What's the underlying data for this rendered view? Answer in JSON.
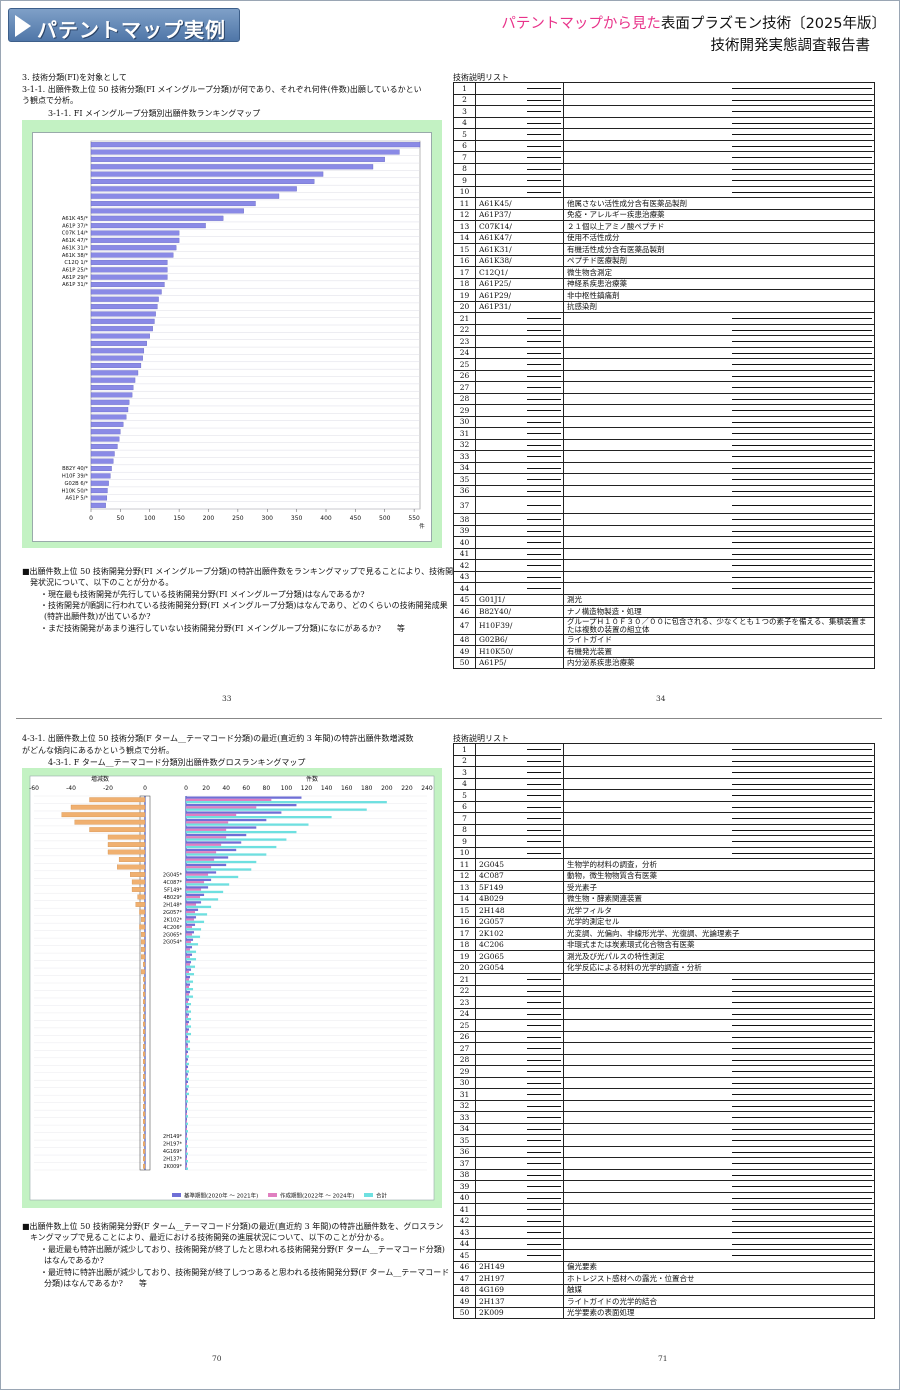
{
  "header": {
    "badge": "パテントマップ実例",
    "subtitle_pink": "パテントマップから見た",
    "subtitle_rest": "表面プラズモン技術〔2025年版〕",
    "subtitle_line2": "技術開発実態調査報告書"
  },
  "top": {
    "heading1": "3. 技術分類(FI)を対象として",
    "heading2": "3-1-1. 出願件数上位 50 技術分類(FI メイングループ分類)が何であり、それぞれ何件(件数)出願しているかとい",
    "heading3": "う観点で分析。",
    "chart_caption": "3-1-1. FI メイングループ分類別出願件数ランキングマップ",
    "notes": [
      "■出願件数上位 50 技術開発分野(FI メイングループ分類)の特許出願件数をランキングマップで見ることにより、技術開",
      "発状況について、以下のことが分かる。",
      "・現在最も技術開発が先行している技術開発分野(FI メイングループ分類)はなんであるか?",
      "・技術開発が順調に行われている技術開発分野(FI メイングループ分類)はなんであり、どのくらいの技術開発成果",
      "(特許出願件数)が出ているか?",
      "・まだ技術開発があまり進行していない技術開発分野(FI メイングループ分類)になにがあるか?　　等"
    ],
    "page_left": "33",
    "page_right": "34",
    "table_title": "技術説明リスト"
  },
  "bottom": {
    "heading1": "4-3-1. 出願件数上位 50 技術分類(F ターム__テーマコード分類)の最近(直近約 3 年間)の特許出願件数増減数",
    "heading2": "がどんな傾向にあるかという観点で分析。",
    "chart_caption": "4-3-1. F ターム__テーマコード分類別出願件数グロスランキングマップ",
    "notes": [
      "■出願件数上位 50 技術開発分野(F ターム__テーマコード分類)の最近(直近約 3 年間)の特許出願件数を、グロスラン",
      "キングマップで見ることにより、最近における技術開発の進展状況について、以下のことが分かる。",
      "・最近最も特許出願が減少しており、技術開発が終了したと思われる技術開発分野(F ターム__テーマコード分類)",
      "はなんであるか?",
      "・最近特に特許出願が減少しており、技術開発が終了しつつあると思われる技術開発分野(F ターム__テーマコード",
      "分類)はなんであるか?　　等"
    ],
    "page_left": "70",
    "page_right": "71",
    "table_title": "技術説明リスト"
  },
  "chart_data": [
    {
      "type": "bar",
      "orientation": "horizontal",
      "title": "3-1-1. FI メイングループ分類別出願件数ランキングマップ",
      "xlabel": "件",
      "xlim": [
        0,
        560
      ],
      "xticks": [
        0,
        50,
        100,
        150,
        200,
        250,
        300,
        350,
        400,
        450,
        500,
        550
      ],
      "grid": true,
      "categories": [
        "",
        "",
        "",
        "",
        "",
        "",
        "",
        "",
        "",
        "",
        "A61K 45/*",
        "A61P 37/*",
        "C07K 14/*",
        "A61K 47/*",
        "A61K 31/*",
        "A61K 38/*",
        "C12Q 1/*",
        "A61P 25/*",
        "A61P 29/*",
        "A61P 31/*",
        "",
        "",
        "",
        "",
        "",
        "",
        "",
        "",
        "",
        "",
        "",
        "",
        "",
        "",
        "",
        "",
        "",
        "",
        "",
        "",
        "",
        "",
        "",
        "",
        "B82Y 40/*",
        "H10F 39/*",
        "G02B 6/*",
        "H10K 50/*",
        "A61P 5/*",
        ""
      ],
      "values": [
        560,
        525,
        500,
        480,
        395,
        380,
        350,
        320,
        280,
        260,
        225,
        195,
        150,
        150,
        145,
        140,
        130,
        130,
        130,
        125,
        120,
        115,
        113,
        110,
        108,
        105,
        100,
        95,
        90,
        88,
        85,
        80,
        75,
        72,
        70,
        65,
        63,
        60,
        55,
        50,
        48,
        45,
        40,
        38,
        35,
        33,
        30,
        28,
        27,
        25
      ]
    },
    {
      "type": "bar",
      "orientation": "horizontal",
      "title": "4-3-1. F ターム__テーマコード分類別出願件数グロスランキングマップ",
      "panels": [
        {
          "xlabel": "増減数",
          "xlim": [
            -60,
            0
          ],
          "xticks": [
            -60,
            -40,
            -20,
            0
          ]
        },
        {
          "xlabel": "件数",
          "xlim": [
            0,
            240
          ],
          "xticks": [
            0,
            20,
            40,
            60,
            80,
            100,
            120,
            140,
            160,
            180,
            200,
            220,
            240
          ]
        }
      ],
      "legend": "bottom-right",
      "categories": [
        "",
        "",
        "",
        "",
        "",
        "",
        "",
        "",
        "",
        "",
        "2G045*",
        "4C087*",
        "5F149*",
        "4B029*",
        "2H148*",
        "2G057*",
        "2K102*",
        "4C206*",
        "2G065*",
        "2G054*",
        "",
        "",
        "",
        "",
        "",
        "",
        "",
        "",
        "",
        "",
        "",
        "",
        "",
        "",
        "",
        "",
        "",
        "",
        "",
        "",
        "",
        "",
        "",
        "",
        "",
        "2H149*",
        "2H197*",
        "4G169*",
        "2H137*",
        "2K009*"
      ],
      "series": [
        {
          "name": "基準期間(2020年 ～ 2021年)",
          "color": "#6f6fd6",
          "values": [
            115,
            110,
            95,
            80,
            70,
            60,
            55,
            50,
            42,
            40,
            30,
            25,
            22,
            18,
            15,
            12,
            10,
            9,
            8,
            7,
            6,
            6,
            5,
            5,
            4,
            4,
            4,
            3,
            3,
            3,
            3,
            3,
            2,
            2,
            2,
            2,
            2,
            2,
            2,
            2,
            1,
            1,
            1,
            1,
            1,
            1,
            1,
            1,
            1,
            1
          ]
        },
        {
          "name": "作成期間(2022年 ～ 2024年)",
          "color": "#e07fc0",
          "values": [
            85,
            70,
            50,
            42,
            40,
            40,
            35,
            30,
            28,
            25,
            22,
            18,
            15,
            14,
            10,
            9,
            8,
            6,
            6,
            5,
            4,
            4,
            4,
            3,
            3,
            3,
            3,
            2,
            2,
            2,
            2,
            2,
            2,
            2,
            1,
            1,
            1,
            1,
            1,
            1,
            1,
            1,
            1,
            1,
            1,
            1,
            1,
            1,
            1,
            1
          ]
        },
        {
          "name": "合計",
          "color": "#6ee0e0",
          "values": [
            200,
            180,
            145,
            122,
            110,
            100,
            90,
            80,
            70,
            65,
            52,
            43,
            37,
            32,
            25,
            21,
            18,
            15,
            14,
            12,
            10,
            10,
            9,
            8,
            7,
            7,
            7,
            5,
            5,
            5,
            5,
            5,
            4,
            4,
            3,
            3,
            3,
            3,
            3,
            3,
            2,
            2,
            2,
            2,
            2,
            2,
            2,
            2,
            2,
            2
          ]
        },
        {
          "name": "増減数",
          "color": "#f0b070",
          "values": [
            -30,
            -40,
            -45,
            -38,
            -30,
            -20,
            -20,
            -20,
            -14,
            -15,
            -8,
            -7,
            -7,
            -4,
            -5,
            -3,
            -2,
            -3,
            -2,
            -2,
            -2,
            -2,
            -1,
            -2,
            -1,
            -1,
            -1,
            -1,
            -1,
            -1,
            -1,
            -1,
            -1,
            -1,
            -1,
            -1,
            -1,
            -1,
            -1,
            -1,
            -1,
            -1,
            -1,
            -1,
            -1,
            -1,
            -1,
            -1,
            -1,
            -1
          ]
        }
      ]
    }
  ],
  "table_top": [
    {
      "n": "1"
    },
    {
      "n": "2"
    },
    {
      "n": "3"
    },
    {
      "n": "4"
    },
    {
      "n": "5"
    },
    {
      "n": "6"
    },
    {
      "n": "7"
    },
    {
      "n": "8"
    },
    {
      "n": "9"
    },
    {
      "n": "10"
    },
    {
      "n": "11",
      "code": "A61K45/",
      "desc": "他属さない活性成分含有医薬品製剤"
    },
    {
      "n": "12",
      "code": "A61P37/",
      "desc": "免疫・アレルギー疾患治療薬"
    },
    {
      "n": "13",
      "code": "C07K14/",
      "desc": "２１個以上アミノ酸ペプチド"
    },
    {
      "n": "14",
      "code": "A61K47/",
      "desc": "使用不活性成分"
    },
    {
      "n": "15",
      "code": "A61K31/",
      "desc": "有機活性成分含有医薬品製剤"
    },
    {
      "n": "16",
      "code": "A61K38/",
      "desc": "ペプチド医療製剤"
    },
    {
      "n": "17",
      "code": "C12Q1/",
      "desc": "微生物含測定"
    },
    {
      "n": "18",
      "code": "A61P25/",
      "desc": "神経系疾患治療薬"
    },
    {
      "n": "19",
      "code": "A61P29/",
      "desc": "非中枢性鎮痛剤"
    },
    {
      "n": "20",
      "code": "A61P31/",
      "desc": "抗感染剤"
    },
    {
      "n": "21"
    },
    {
      "n": "22"
    },
    {
      "n": "23"
    },
    {
      "n": "24"
    },
    {
      "n": "25"
    },
    {
      "n": "26"
    },
    {
      "n": "27"
    },
    {
      "n": "28"
    },
    {
      "n": "29"
    },
    {
      "n": "30"
    },
    {
      "n": "31"
    },
    {
      "n": "32"
    },
    {
      "n": "33"
    },
    {
      "n": "34"
    },
    {
      "n": "35"
    },
    {
      "n": "36"
    },
    {
      "n": "37",
      "tall": true
    },
    {
      "n": "38"
    },
    {
      "n": "39"
    },
    {
      "n": "40"
    },
    {
      "n": "41"
    },
    {
      "n": "42"
    },
    {
      "n": "43"
    },
    {
      "n": "44"
    },
    {
      "n": "45",
      "code": "G01J1/",
      "desc": "測光"
    },
    {
      "n": "46",
      "code": "B82Y40/",
      "desc": "ナノ構造物製造・処理"
    },
    {
      "n": "47",
      "code": "H10F39/",
      "desc": "グループＨ１０Ｆ３０／００に包含される、少なくとも１つの素子を備える、集積装置または複数の装置の組立体",
      "tall": true
    },
    {
      "n": "48",
      "code": "G02B6/",
      "desc": "ライトガイド"
    },
    {
      "n": "49",
      "code": "H10K50/",
      "desc": "有機発光装置"
    },
    {
      "n": "50",
      "code": "A61P5/",
      "desc": "内分泌系疾患治療薬"
    }
  ],
  "table_bottom": [
    {
      "n": "1"
    },
    {
      "n": "2"
    },
    {
      "n": "3"
    },
    {
      "n": "4"
    },
    {
      "n": "5"
    },
    {
      "n": "6"
    },
    {
      "n": "7"
    },
    {
      "n": "8"
    },
    {
      "n": "9"
    },
    {
      "n": "10"
    },
    {
      "n": "11",
      "code": "2G045",
      "desc": "生物学的材料の調査，分析"
    },
    {
      "n": "12",
      "code": "4C087",
      "desc": "動物，微生物物質含有医薬"
    },
    {
      "n": "13",
      "code": "5F149",
      "desc": "受光素子"
    },
    {
      "n": "14",
      "code": "4B029",
      "desc": "微生物・酵素関連装置"
    },
    {
      "n": "15",
      "code": "2H148",
      "desc": "光学フィルタ"
    },
    {
      "n": "16",
      "code": "2G057",
      "desc": "光学的測定セル"
    },
    {
      "n": "17",
      "code": "2K102",
      "desc": "光変調、光偏向、非線形光学、光復調、光論理素子"
    },
    {
      "n": "18",
      "code": "4C206",
      "desc": "非環式または炭素環式化合物含有医薬"
    },
    {
      "n": "19",
      "code": "2G065",
      "desc": "測光及び光パルスの特性測定"
    },
    {
      "n": "20",
      "code": "2G054",
      "desc": "化学反応による材料の光学的調査・分析"
    },
    {
      "n": "21"
    },
    {
      "n": "22"
    },
    {
      "n": "23"
    },
    {
      "n": "24"
    },
    {
      "n": "25"
    },
    {
      "n": "26"
    },
    {
      "n": "27"
    },
    {
      "n": "28"
    },
    {
      "n": "29"
    },
    {
      "n": "30"
    },
    {
      "n": "31"
    },
    {
      "n": "32"
    },
    {
      "n": "33"
    },
    {
      "n": "34"
    },
    {
      "n": "35"
    },
    {
      "n": "36"
    },
    {
      "n": "37"
    },
    {
      "n": "38"
    },
    {
      "n": "39"
    },
    {
      "n": "40"
    },
    {
      "n": "41"
    },
    {
      "n": "42"
    },
    {
      "n": "43"
    },
    {
      "n": "44"
    },
    {
      "n": "45"
    },
    {
      "n": "46",
      "code": "2H149",
      "desc": "偏光要素"
    },
    {
      "n": "47",
      "code": "2H197",
      "desc": "ホトレジスト感材への露光・位置合せ"
    },
    {
      "n": "48",
      "code": "4G169",
      "desc": "触媒"
    },
    {
      "n": "49",
      "code": "2H137",
      "desc": "ライトガイドの光学的結合"
    },
    {
      "n": "50",
      "code": "2K009",
      "desc": "光学要素の表面処理"
    }
  ]
}
